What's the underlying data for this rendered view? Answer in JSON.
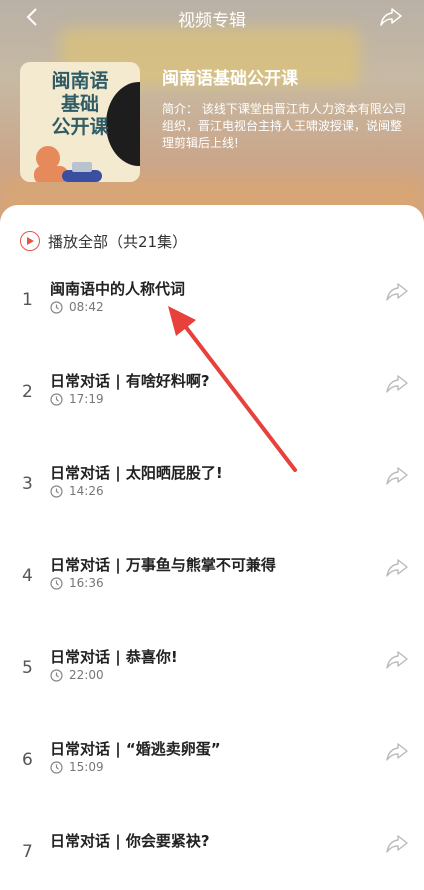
{
  "header": {
    "title": "视频专辑",
    "back_icon": "chevron-left-icon",
    "share_icon": "share-arrow-icon"
  },
  "album": {
    "cover_text": [
      "闽南语",
      "基础",
      "公开课"
    ],
    "name": "闽南语基础公开课",
    "description": "简介：  该线下课堂由晋江市人力资本有限公司组织，晋江电视台主持人王啸波授课，说闽整理剪辑后上线!"
  },
  "playlist": {
    "play_all_label": "播放全部（共21集）",
    "episodes": [
      {
        "index": "1",
        "title": "闽南语中的人称代词",
        "duration": "08:42"
      },
      {
        "index": "2",
        "title": "日常对话 | 有啥好料啊?",
        "duration": "17:19"
      },
      {
        "index": "3",
        "title": "日常对话 | 太阳晒屁股了!",
        "duration": "14:26"
      },
      {
        "index": "4",
        "title": "日常对话 | 万事鱼与熊掌不可兼得",
        "duration": "16:36"
      },
      {
        "index": "5",
        "title": "日常对话 | 恭喜你!",
        "duration": "22:00"
      },
      {
        "index": "6",
        "title": "日常对话 | “婚逃卖卵蛋”",
        "duration": "15:09"
      },
      {
        "index": "7",
        "title": "日常对话 | 你会要紧袂?",
        "duration": ""
      }
    ]
  },
  "colors": {
    "accent": "#e2554a",
    "annotation_arrow": "#e8403a"
  }
}
